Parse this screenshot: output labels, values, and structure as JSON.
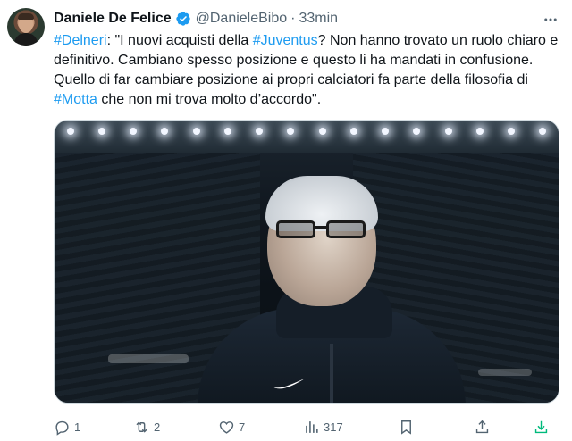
{
  "author": {
    "name": "Daniele De Felice",
    "handle": "@DanieleBibo",
    "separator": "·",
    "time": "33min",
    "verified_color": "#1d9bf0"
  },
  "tweet": {
    "segments": [
      {
        "text": "#Delneri",
        "hashtag": true
      },
      {
        "text": ": \"I nuovi acquisti della ",
        "hashtag": false
      },
      {
        "text": "#Juventus",
        "hashtag": true
      },
      {
        "text": "? Non hanno trovato un ruolo chiaro e definitivo. Cambiano spesso posizione e questo li ha mandati in confusione. Quello di far cambiare posizione ai propri calciatori fa parte della filosofia di ",
        "hashtag": false
      },
      {
        "text": "#Motta",
        "hashtag": true
      },
      {
        "text": " che non mi trova molto d’accordo\".",
        "hashtag": false
      }
    ]
  },
  "actions": {
    "replies": "1",
    "retweets": "2",
    "likes": "7",
    "views": "317"
  },
  "colors": {
    "text": "#0f1419",
    "muted": "#536471",
    "accent": "#1d9bf0",
    "download": "#00ba7c"
  },
  "icons": {
    "more": "more-icon",
    "reply": "reply-icon",
    "retweet": "retweet-icon",
    "like": "heart-icon",
    "views": "views-icon",
    "bookmark": "bookmark-icon",
    "share": "share-icon",
    "download": "download-icon"
  }
}
